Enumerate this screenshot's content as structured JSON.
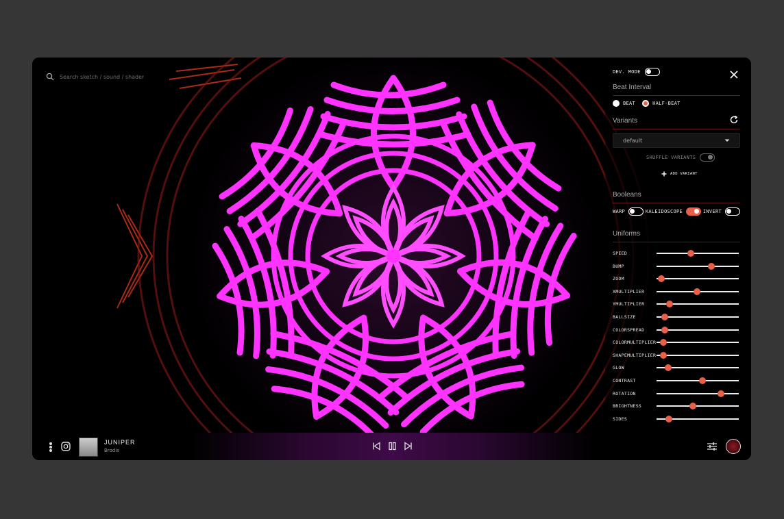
{
  "search": {
    "placeholder": "Search sketch / sound / shader"
  },
  "panel": {
    "dev_mode_label": "DEV. MODE",
    "beat_interval_title": "Beat Interval",
    "beat_options": [
      {
        "label": "BEAT",
        "selected": false
      },
      {
        "label": "HALF-BEAT",
        "selected": true
      }
    ],
    "variants_title": "Variants",
    "variant_selected": "default",
    "shuffle_label": "SHUFFLE VARIANTS",
    "add_variant_label": "ADD VARIANT",
    "booleans_title": "Booleans",
    "booleans": [
      {
        "label": "WARP",
        "on": false
      },
      {
        "label": "KALEIDOSCOPE",
        "on": true
      },
      {
        "label": "INVERT",
        "on": false
      }
    ],
    "uniforms_title": "Uniforms",
    "uniforms": [
      {
        "label": "SPEED",
        "value": 0.42
      },
      {
        "label": "BUMP",
        "value": 0.67
      },
      {
        "label": "ZOOM",
        "value": 0.06
      },
      {
        "label": "XMULTIPLIER",
        "value": 0.49
      },
      {
        "label": "YMULTIPLIER",
        "value": 0.16
      },
      {
        "label": "BALLSIZE",
        "value": 0.1
      },
      {
        "label": "COLORSPREAD",
        "value": 0.1
      },
      {
        "label": "COLORMULTIPLIER",
        "value": 0.08
      },
      {
        "label": "SHAPEMULTIPLIER",
        "value": 0.08
      },
      {
        "label": "GLOW",
        "value": 0.14
      },
      {
        "label": "CONTRAST",
        "value": 0.56
      },
      {
        "label": "ROTATION",
        "value": 0.78
      },
      {
        "label": "BRIGHTNESS",
        "value": 0.44
      },
      {
        "label": "SIDES",
        "value": 0.15
      }
    ]
  },
  "player": {
    "title": "JUNIPER",
    "artist": "Brodis"
  },
  "colors": {
    "accent": "#e8604a",
    "magenta": "#ff33ff",
    "ember": "#e8402a"
  },
  "icons": [
    "search-icon",
    "close-icon",
    "refresh-icon",
    "chevron-down-icon",
    "plus-icon",
    "more-icon",
    "instagram-icon",
    "previous-icon",
    "pause-icon",
    "next-icon",
    "mixer-icon"
  ]
}
